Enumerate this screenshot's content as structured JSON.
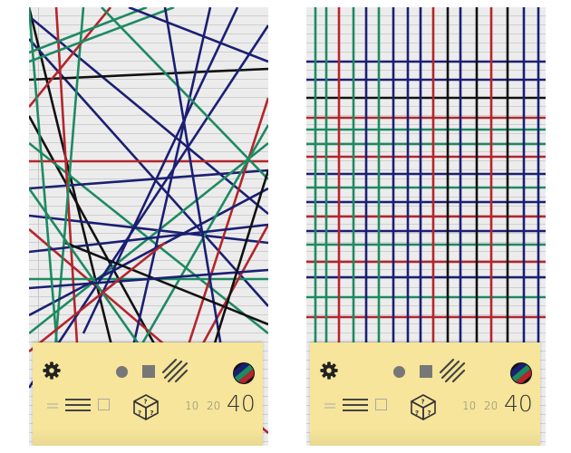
{
  "colors": {
    "paper": "#ececec",
    "ruled_line": "#cfcfcf",
    "sticky_note": "#f6e59a",
    "line_black": "#111111",
    "line_navy": "#1b1f73",
    "line_red": "#b3262c",
    "line_green": "#1d8a62",
    "control_icon": "#777777"
  },
  "screens": [
    {
      "pattern": "random",
      "controls": {
        "settings_icon": "gear-icon",
        "shape_options": [
          "circle-icon",
          "square-icon",
          "hatch-icon"
        ],
        "palette_icon": "palette-icon",
        "density_options": [
          "thin-lines-icon",
          "triple-lines-icon",
          "empty-square-icon"
        ],
        "random_icon": "dice-icon",
        "count_options": [
          "10",
          "20",
          "40"
        ],
        "selected_count": "40"
      }
    },
    {
      "pattern": "grid",
      "controls": {
        "settings_icon": "gear-icon",
        "shape_options": [
          "circle-icon",
          "square-icon",
          "hatch-icon"
        ],
        "palette_icon": "palette-icon",
        "density_options": [
          "thin-lines-icon",
          "triple-lines-icon",
          "empty-square-icon"
        ],
        "random_icon": "dice-icon",
        "count_options": [
          "10",
          "20",
          "40"
        ],
        "selected_count": "40"
      }
    }
  ]
}
